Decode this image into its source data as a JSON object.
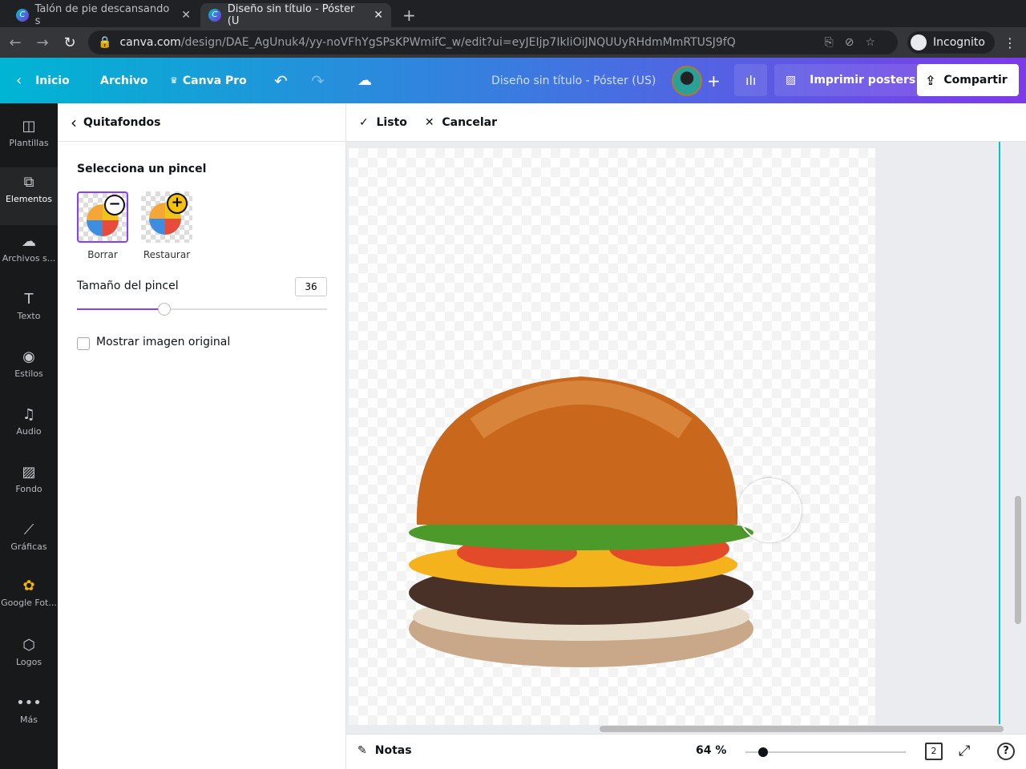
{
  "browser": {
    "tabs": [
      {
        "title": "Talón de pie descansando s"
      },
      {
        "title": "Diseño sin título - Póster (U"
      }
    ],
    "url_domain": "canva.com",
    "url_path": "/design/DAE_AgUnuk4/yy-noVFhYgSPsKPWmifC_w/edit?ui=eyJEIjp7IkIiOiJNQUUyRHdmMmRTUSJ9fQ",
    "profile": "Incognito"
  },
  "topbar": {
    "home": "Inicio",
    "file": "Archivo",
    "pro": "Canva Pro",
    "title": "Diseño sin título - Póster (US)",
    "print": "Imprimir posters",
    "share": "Compartir"
  },
  "sidebar": {
    "items": [
      {
        "label": "Plantillas",
        "icon": "template-icon"
      },
      {
        "label": "Elementos",
        "icon": "elements-icon"
      },
      {
        "label": "Archivos s...",
        "icon": "upload-icon"
      },
      {
        "label": "Texto",
        "icon": "text-icon"
      },
      {
        "label": "Estilos",
        "icon": "palette-icon"
      },
      {
        "label": "Audio",
        "icon": "music-icon"
      },
      {
        "label": "Fondo",
        "icon": "background-icon"
      },
      {
        "label": "Gráficas",
        "icon": "chart-icon"
      },
      {
        "label": "Google Fot...",
        "icon": "google-photos-icon"
      },
      {
        "label": "Logos",
        "icon": "logo-icon"
      },
      {
        "label": "Más",
        "icon": "more-icon"
      }
    ]
  },
  "panel": {
    "title": "Quitafondos",
    "brush_heading": "Selecciona un pincel",
    "erase": "Borrar",
    "restore": "Restaurar",
    "size_label": "Tamaño del pincel",
    "size_value": "36",
    "size_fraction": 0.35,
    "show_original": "Mostrar imagen original",
    "show_original_checked": false
  },
  "canvas": {
    "done": "Listo",
    "cancel": "Cancelar",
    "notes": "Notas",
    "zoom": "64 %",
    "zoom_fraction": 0.11,
    "page_count": "2"
  }
}
